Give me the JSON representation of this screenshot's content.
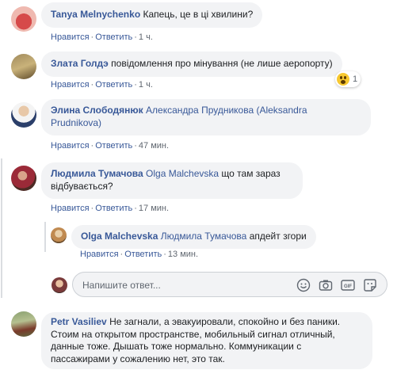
{
  "comments": [
    {
      "author": "Tanya Melnychenko",
      "text": "Капець, це в ці хвилини?",
      "like_label": "Нравится",
      "reply_label": "Ответить",
      "time": "1 ч."
    },
    {
      "author": "Злата Голдэ",
      "text": "повідомлення про мінування (не лише аеропорту)",
      "like_label": "Нравится",
      "reply_label": "Ответить",
      "time": "1 ч.",
      "reaction": {
        "icon": "wow-reaction-icon",
        "count": "1"
      }
    },
    {
      "author": "Элина Слободянюк",
      "mention_line1": "Александра Прудникова (Aleksandra",
      "mention_line2": "Prudnikova)",
      "like_label": "Нравится",
      "reply_label": "Ответить",
      "time": "47 мин."
    },
    {
      "author": "Людмила Тумачова",
      "mention": "Olga Malchevska",
      "text_line1": "що там зараз",
      "text_line2": "відбувається?",
      "like_label": "Нравится",
      "reply_label": "Ответить",
      "time": "17 мин.",
      "reply": {
        "author": "Olga Malchevska",
        "mention": "Людмила Тумачова",
        "text": "апдейт згори",
        "like_label": "Нравится",
        "reply_label": "Ответить",
        "time": "13 мин."
      }
    },
    {
      "author": "Petr Vasiliev",
      "line1": "Не загнали, а эвакуировали, спокойно и без паники.",
      "line2": "Стоим на открытом пространстве, мобильный сигнал отличный,",
      "line3": "данные тоже. Дышать тоже нормально. Коммуникации с",
      "line4": "пассажирами у сожалению нет, это так."
    }
  ],
  "reply_input": {
    "placeholder": "Напишите ответ...",
    "icons": [
      "emoji-icon",
      "camera-icon",
      "gif-icon",
      "sticker-icon"
    ]
  },
  "colors": {
    "link": "#385898",
    "bubble": "#f2f3f5",
    "meta": "#606770"
  }
}
